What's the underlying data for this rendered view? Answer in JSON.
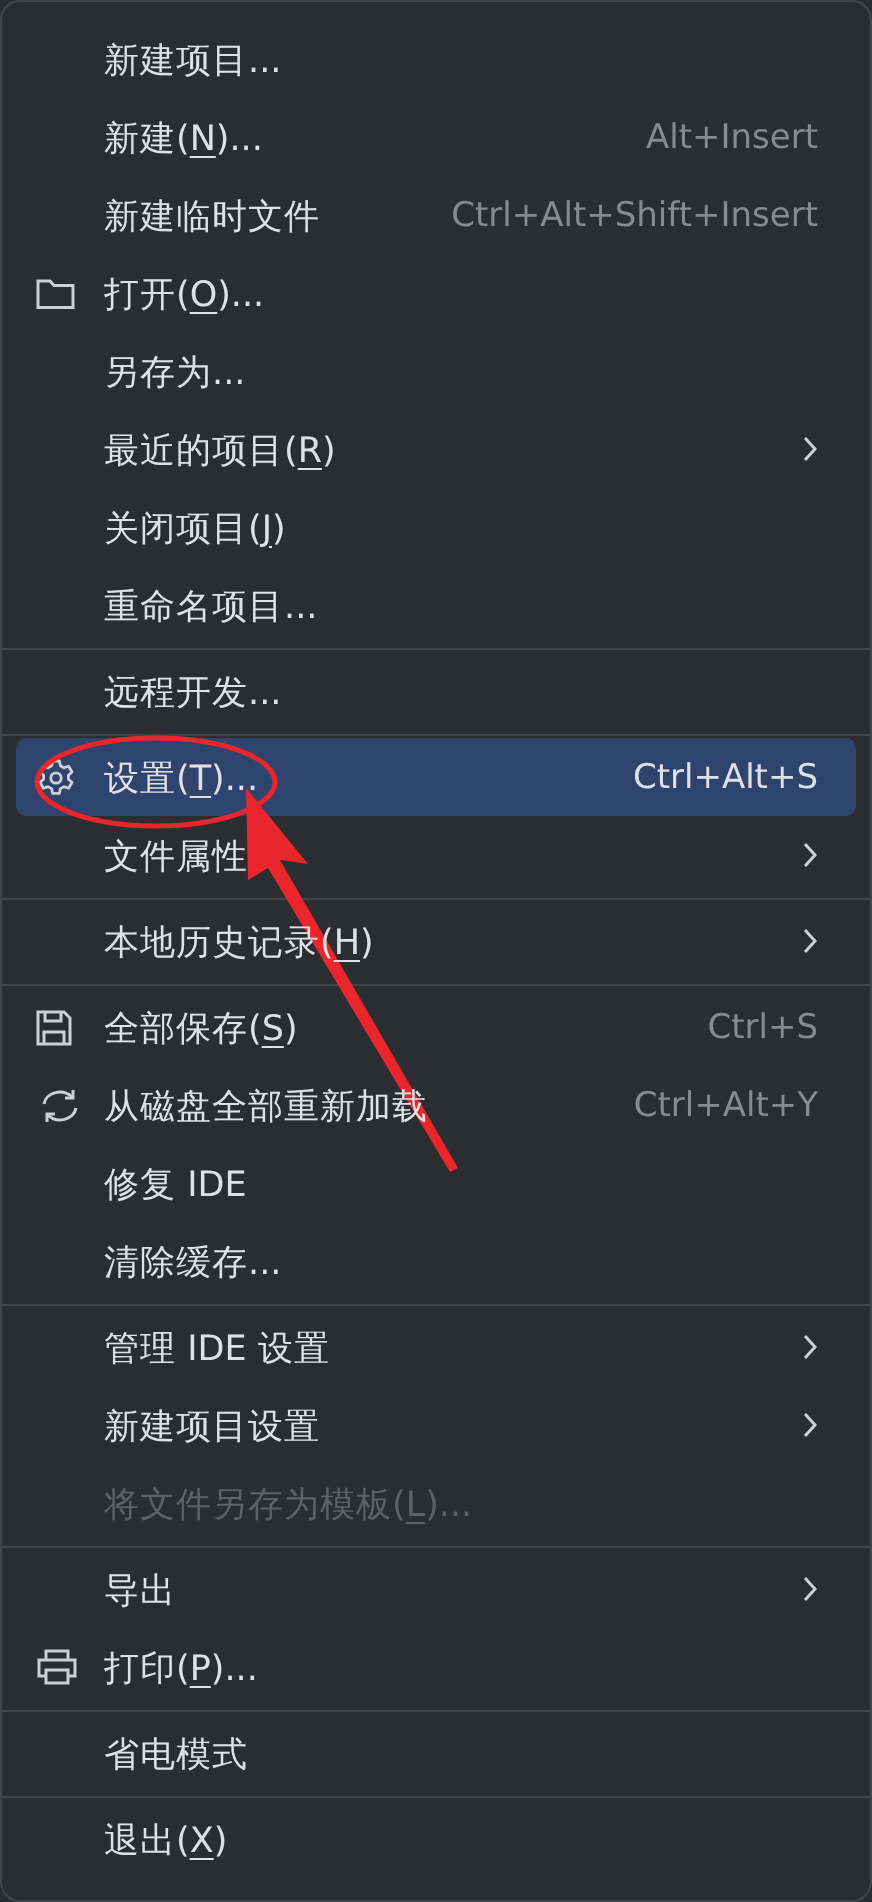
{
  "menu": {
    "groups": [
      {
        "items": [
          {
            "label": "新建项目...",
            "submenu": false,
            "disabled": false,
            "selected": false
          },
          {
            "label_start": "新建(",
            "mnemonic": "N",
            "label_end": ")...",
            "shortcut": "Alt+Insert",
            "submenu": false,
            "disabled": false,
            "selected": false
          },
          {
            "label": "新建临时文件",
            "shortcut": "Ctrl+Alt+Shift+Insert",
            "submenu": false,
            "disabled": false,
            "selected": false
          },
          {
            "kind": "folder",
            "label_start": "打开(",
            "mnemonic": "O",
            "label_end": ")...",
            "submenu": false,
            "disabled": false,
            "selected": false
          },
          {
            "label": "另存为...",
            "submenu": false,
            "disabled": false,
            "selected": false
          },
          {
            "label_start": "最近的项目(",
            "mnemonic": "R",
            "label_end": ")",
            "submenu": true,
            "disabled": false,
            "selected": false
          },
          {
            "label_start": "关闭项目(",
            "mnemonic": "J",
            "label_end": ")",
            "submenu": false,
            "disabled": false,
            "selected": false
          },
          {
            "label": "重命名项目...",
            "submenu": false,
            "disabled": false,
            "selected": false
          }
        ]
      },
      {
        "items": [
          {
            "label": "远程开发...",
            "submenu": false,
            "disabled": false,
            "selected": false
          }
        ]
      },
      {
        "items": [
          {
            "kind": "gear",
            "label_start": "设置(",
            "mnemonic": "T",
            "label_end": ")...",
            "shortcut": "Ctrl+Alt+S",
            "submenu": false,
            "disabled": false,
            "selected": true
          },
          {
            "label": "文件属性",
            "submenu": true,
            "disabled": false,
            "selected": false
          }
        ]
      },
      {
        "items": [
          {
            "label_start": "本地历史记录(",
            "mnemonic": "H",
            "label_end": ")",
            "submenu": true,
            "disabled": false,
            "selected": false
          }
        ]
      },
      {
        "items": [
          {
            "kind": "save",
            "label_start": "全部保存(",
            "mnemonic": "S",
            "label_end": ")",
            "shortcut": "Ctrl+S",
            "submenu": false,
            "disabled": false,
            "selected": false
          },
          {
            "kind": "reload",
            "label": "从磁盘全部重新加载",
            "shortcut": "Ctrl+Alt+Y",
            "submenu": false,
            "disabled": false,
            "selected": false
          },
          {
            "label": "修复 IDE",
            "submenu": false,
            "disabled": false,
            "selected": false
          },
          {
            "label": "清除缓存...",
            "submenu": false,
            "disabled": false,
            "selected": false
          }
        ]
      },
      {
        "items": [
          {
            "label": "管理 IDE 设置",
            "submenu": true,
            "disabled": false,
            "selected": false
          },
          {
            "label": "新建项目设置",
            "submenu": true,
            "disabled": false,
            "selected": false
          },
          {
            "label_start": "将文件另存为模板(",
            "mnemonic": "L",
            "label_end": ")...",
            "submenu": false,
            "disabled": true,
            "selected": false
          }
        ]
      },
      {
        "items": [
          {
            "label": "导出",
            "submenu": true,
            "disabled": false,
            "selected": false
          },
          {
            "kind": "print",
            "label_start": "打印(",
            "mnemonic": "P",
            "label_end": ")...",
            "submenu": false,
            "disabled": false,
            "selected": false
          }
        ]
      },
      {
        "items": [
          {
            "label": "省电模式",
            "submenu": false,
            "disabled": false,
            "selected": false
          }
        ]
      },
      {
        "items": [
          {
            "label_start": "退出(",
            "mnemonic": "X",
            "label_end": ")",
            "submenu": false,
            "disabled": false,
            "selected": false
          }
        ]
      }
    ]
  },
  "annotation": {
    "kind": "circle-and-arrow"
  }
}
